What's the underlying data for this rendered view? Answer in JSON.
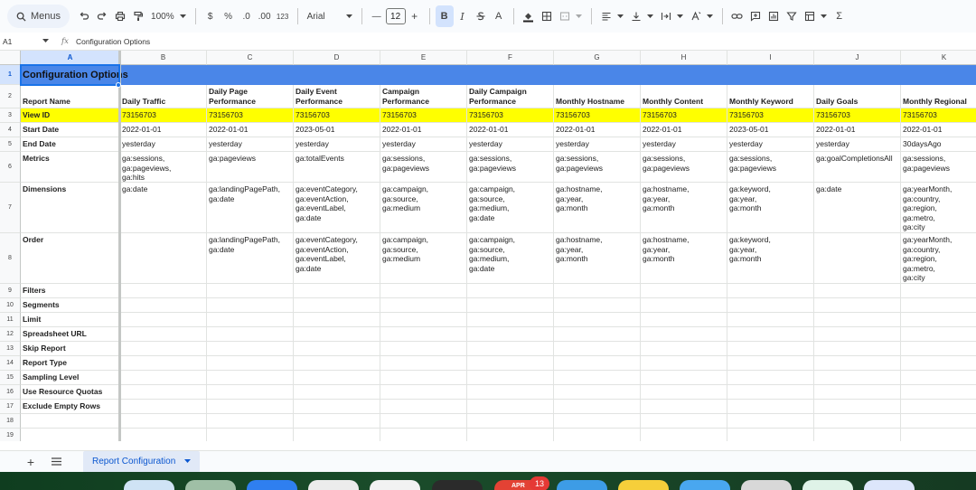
{
  "toolbar": {
    "menus_label": "Menus",
    "zoom": "100%",
    "currency": "$",
    "percent": "%",
    "dec_decrease": ".0",
    "dec_increase": ".00",
    "number_format": "123",
    "font_name": "Arial",
    "font_size": "12",
    "minus": "—",
    "plus": "+",
    "bold": "B",
    "italic": "I",
    "text_color": "A",
    "sum": "Σ"
  },
  "formula_bar": {
    "cell_ref": "A1",
    "fx": "fx",
    "content": "Configuration Options"
  },
  "columns": [
    "A",
    "B",
    "C",
    "D",
    "E",
    "F",
    "G",
    "H",
    "I",
    "J",
    "K"
  ],
  "rows": [
    "1",
    "2",
    "3",
    "4",
    "5",
    "6",
    "7",
    "8",
    "9",
    "10",
    "11",
    "12",
    "13",
    "14",
    "15",
    "16",
    "17",
    "18",
    "19"
  ],
  "title_cell": "Configuration Options",
  "labels": [
    "Report Name",
    "View ID",
    "Start Date",
    "End Date",
    "Metrics",
    "Dimensions",
    "Order",
    "Filters",
    "Segments",
    "Limit",
    "Spreadsheet URL",
    "Skip Report",
    "Report Type",
    "Sampling Level",
    "Use Resource Quotas",
    "Exclude Empty Rows"
  ],
  "reports": [
    {
      "name": [
        "Daily Traffic"
      ],
      "view_id": "73156703",
      "start": "2022-01-01",
      "end": "yesterday",
      "metrics": [
        "ga:sessions,",
        "ga:pageviews,",
        "ga:hits"
      ],
      "dimensions": [
        "ga:date"
      ],
      "order": []
    },
    {
      "name": [
        "Daily Page",
        "Performance"
      ],
      "view_id": "73156703",
      "start": "2022-01-01",
      "end": "yesterday",
      "metrics": [
        "ga:pageviews"
      ],
      "dimensions": [
        "ga:landingPagePath,",
        "ga:date"
      ],
      "order": [
        "ga:landingPagePath,",
        "ga:date"
      ]
    },
    {
      "name": [
        "Daily Event",
        "Performance"
      ],
      "view_id": "73156703",
      "start": "2023-05-01",
      "end": "yesterday",
      "metrics": [
        "ga:totalEvents"
      ],
      "dimensions": [
        "ga:eventCategory,",
        "ga:eventAction,",
        "ga:eventLabel,",
        "ga:date"
      ],
      "order": [
        "ga:eventCategory,",
        "ga:eventAction,",
        "ga:eventLabel,",
        "ga:date"
      ]
    },
    {
      "name": [
        "Campaign",
        "Performance"
      ],
      "view_id": "73156703",
      "start": "2022-01-01",
      "end": "yesterday",
      "metrics": [
        "ga:sessions,",
        "ga:pageviews"
      ],
      "dimensions": [
        "ga:campaign,",
        "ga:source,",
        "ga:medium"
      ],
      "order": [
        "ga:campaign,",
        "ga:source,",
        "ga:medium"
      ]
    },
    {
      "name": [
        "Daily Campaign",
        "Performance"
      ],
      "view_id": "73156703",
      "start": "2022-01-01",
      "end": "yesterday",
      "metrics": [
        "ga:sessions,",
        "ga:pageviews"
      ],
      "dimensions": [
        "ga:campaign,",
        "ga:source,",
        "ga:medium,",
        "ga:date"
      ],
      "order": [
        "ga:campaign,",
        "ga:source,",
        "ga:medium,",
        "ga:date"
      ]
    },
    {
      "name": [
        "Monthly Hostname"
      ],
      "view_id": "73156703",
      "start": "2022-01-01",
      "end": "yesterday",
      "metrics": [
        "ga:sessions,",
        "ga:pageviews"
      ],
      "dimensions": [
        "ga:hostname,",
        "ga:year,",
        "ga:month"
      ],
      "order": [
        "ga:hostname,",
        "ga:year,",
        "ga:month"
      ]
    },
    {
      "name": [
        "Monthly Content"
      ],
      "view_id": "73156703",
      "start": "2022-01-01",
      "end": "yesterday",
      "metrics": [
        "ga:sessions,",
        "ga:pageviews"
      ],
      "dimensions": [
        "ga:hostname,",
        "ga:year,",
        "ga:month"
      ],
      "order": [
        "ga:hostname,",
        "ga:year,",
        "ga:month"
      ]
    },
    {
      "name": [
        "Monthly Keyword"
      ],
      "view_id": "73156703",
      "start": "2023-05-01",
      "end": "yesterday",
      "metrics": [
        "ga:sessions,",
        "ga:pageviews"
      ],
      "dimensions": [
        "ga:keyword,",
        "ga:year,",
        "ga:month"
      ],
      "order": [
        "ga:keyword,",
        "ga:year,",
        "ga:month"
      ]
    },
    {
      "name": [
        "Daily Goals"
      ],
      "view_id": "73156703",
      "start": "2022-01-01",
      "end": "yesterday",
      "metrics": [
        "ga:goalCompletionsAll"
      ],
      "dimensions": [
        "ga:date"
      ],
      "order": []
    },
    {
      "name": [
        "Monthly Regional"
      ],
      "view_id": "73156703",
      "start": "2022-01-01",
      "end": "30daysAgo",
      "metrics": [
        "ga:sessions,",
        "ga:pageviews"
      ],
      "dimensions": [
        "ga:yearMonth,",
        "ga:country,",
        "ga:region,",
        "ga:metro,",
        "ga:city"
      ],
      "order": [
        "ga:yearMonth,",
        "ga:country,",
        "ga:region,",
        "ga:metro,",
        "ga:city"
      ]
    }
  ],
  "sheet_tab": "Report Configuration",
  "dock": {
    "calendar_month": "APR",
    "calendar_badge": "13"
  },
  "colors": {
    "title_row": "#4a86e8",
    "highlight_row": "#ffff00",
    "selection": "#1a73e8"
  }
}
